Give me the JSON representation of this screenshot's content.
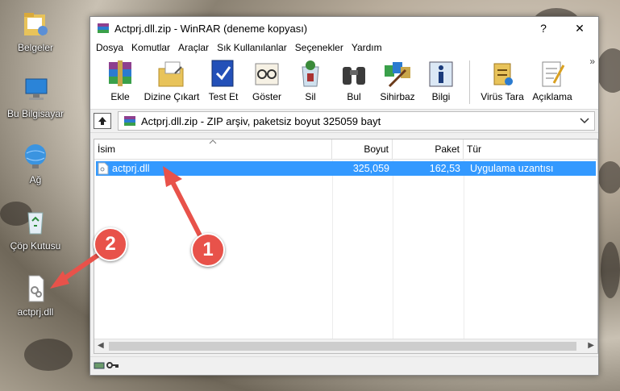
{
  "desktop": {
    "icons": [
      {
        "label": "Belgeler"
      },
      {
        "label": "Bu Bilgisayar"
      },
      {
        "label": "Ağ"
      },
      {
        "label": "Çöp Kutusu"
      },
      {
        "label": "actprj.dll"
      }
    ]
  },
  "window": {
    "title": "Actprj.dll.zip - WinRAR (deneme kopyası)",
    "help_btn": "?",
    "close_btn": "✕"
  },
  "menu": [
    "Dosya",
    "Komutlar",
    "Araçlar",
    "Sık Kullanılanlar",
    "Seçenekler",
    "Yardım"
  ],
  "toolbar": [
    {
      "label": "Ekle",
      "icon": "add-icon"
    },
    {
      "label": "Dizine Çıkart",
      "icon": "extract-icon"
    },
    {
      "label": "Test Et",
      "icon": "test-icon"
    },
    {
      "label": "Göster",
      "icon": "view-icon"
    },
    {
      "label": "Sil",
      "icon": "delete-icon"
    },
    {
      "label": "Bul",
      "icon": "find-icon"
    },
    {
      "label": "Sihirbaz",
      "icon": "wizard-icon"
    },
    {
      "label": "Bilgi",
      "icon": "info-icon"
    },
    {
      "label": "Virüs Tara",
      "icon": "virus-scan-icon"
    },
    {
      "label": "Açıklama",
      "icon": "comment-icon"
    }
  ],
  "toolbar_more": "»",
  "address": {
    "text": "Actprj.dll.zip - ZIP arşiv, paketsiz boyut 325059 bayt"
  },
  "columns": {
    "name": "İsim",
    "size": "Boyut",
    "packed": "Paket",
    "type": "Tür"
  },
  "files": [
    {
      "name": "actprj.dll",
      "size": "325,059",
      "packed": "162,53",
      "type": "Uygulama uzantısı"
    }
  ],
  "annotations": {
    "badge1": "1",
    "badge2": "2"
  },
  "colors": {
    "selection": "#3399ff",
    "annotation": "#e8524a"
  }
}
